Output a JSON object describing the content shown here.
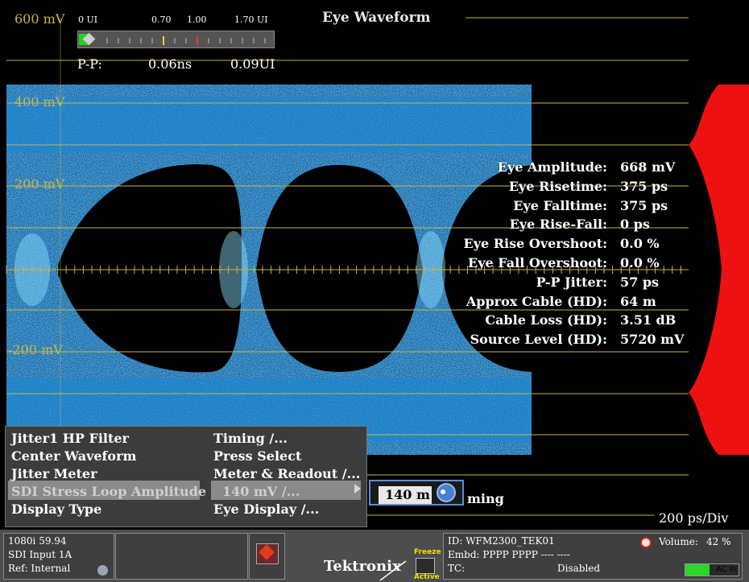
{
  "title": "Eye Waveform",
  "scale_labels": [
    "600 mV",
    "400 mV",
    "200 mV",
    "-200 mV"
  ],
  "jitter_meter": {
    "ticks": [
      "0 UI",
      "0.70",
      "1.00",
      "1.70 UI"
    ],
    "pp_label": "P-P:",
    "pp_time": "0.06ns",
    "pp_ui": "0.09UI"
  },
  "readouts": [
    {
      "label": "Eye Amplitude:",
      "value": "668 mV"
    },
    {
      "label": "Eye Risetime:",
      "value": "375 ps"
    },
    {
      "label": "Eye Falltime:",
      "value": "375 ps"
    },
    {
      "label": "Eye Rise-Fall:",
      "value": "0 ps"
    },
    {
      "label": "Eye Rise Overshoot:",
      "value": "0.0 %"
    },
    {
      "label": "Eye Fall Overshoot:",
      "value": "0.0 %"
    },
    {
      "label": "P-P Jitter:",
      "value": "57 ps"
    },
    {
      "label": "Approx Cable (HD):",
      "value": "64 m"
    },
    {
      "label": "Cable Loss (HD):",
      "value": "3.51 dB"
    },
    {
      "label": "Source Level (HD):",
      "value": "5720 mV"
    }
  ],
  "menu": {
    "left": [
      "Jitter1 HP Filter",
      "Center Waveform",
      "Jitter Meter",
      "SDI Stress Loop Amplitude",
      "Display Type"
    ],
    "right": [
      "Timing /...",
      "Press Select",
      "Meter & Readout /...",
      "140 mV /...",
      "Eye Display /..."
    ],
    "selected_index": 3
  },
  "knob": {
    "value": "140 m"
  },
  "timing_partial": "ming",
  "timebase": "200 ps/Div",
  "status": {
    "format": "1080i 59.94",
    "input": "SDI Input 1A",
    "ref": "Ref: Internal",
    "logo": "Tektronix",
    "freeze": "Freeze",
    "active": "Active",
    "id": "ID: WFM2300_TEK01",
    "embd": "Embd: PPPP PPPP ---- ----",
    "tc_label": "TC:",
    "tc_value": "Disabled",
    "volume_label": "Volume:",
    "volume_value": "42 %",
    "ac_in": "AC In",
    "ac_level": 0.45
  },
  "colors": {
    "graticule": "#c8b54a",
    "trace": "#28a8f0",
    "histogram": "#ee1111"
  }
}
